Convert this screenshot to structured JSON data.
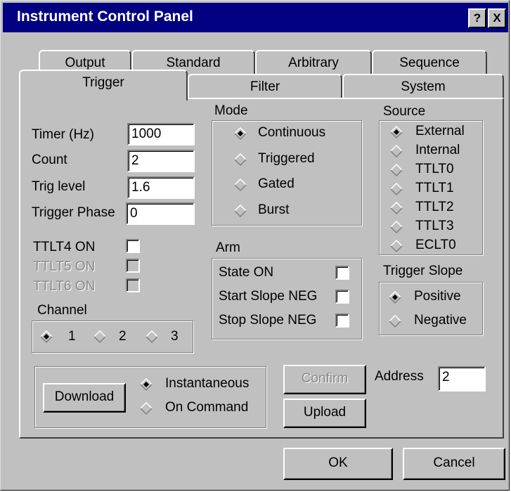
{
  "window": {
    "title": "Instrument Control Panel",
    "help_label": "?",
    "close_label": "X"
  },
  "tabs": {
    "row1": [
      "Output",
      "Standard",
      "Arbitrary",
      "Sequence"
    ],
    "row2": [
      "Trigger",
      "Filter",
      "System"
    ],
    "active": "Trigger"
  },
  "trigger": {
    "timer_label": "Timer (Hz)",
    "timer_value": "1000",
    "count_label": "Count",
    "count_value": "2",
    "level_label": "Trig level",
    "level_value": "1.6",
    "phase_label": "Trigger Phase",
    "phase_value": "0",
    "ttlt4_label": "TTLT4 ON",
    "ttlt4_checked": false,
    "ttlt5_label": "TTLT5 ON",
    "ttlt5_enabled": false,
    "ttlt6_label": "TTLT6 ON",
    "ttlt6_enabled": false
  },
  "channel": {
    "label": "Channel",
    "options": [
      "1",
      "2",
      "3"
    ],
    "selected": "1"
  },
  "mode": {
    "label": "Mode",
    "options": [
      "Continuous",
      "Triggered",
      "Gated",
      "Burst"
    ],
    "selected": "Continuous"
  },
  "arm": {
    "label": "Arm",
    "state_label": "State ON",
    "start_label": "Start Slope NEG",
    "stop_label": "Stop Slope NEG"
  },
  "source": {
    "label": "Source",
    "options": [
      "External",
      "Internal",
      "TTLT0",
      "TTLT1",
      "TTLT2",
      "TTLT3",
      "ECLT0"
    ],
    "selected": "External"
  },
  "slope": {
    "label": "Trigger Slope",
    "options": [
      "Positive",
      "Negative"
    ],
    "selected": "Positive"
  },
  "download": {
    "button_label": "Download",
    "options": [
      "Instantaneous",
      "On Command"
    ],
    "selected": "Instantaneous"
  },
  "actions": {
    "confirm_label": "Confirm",
    "upload_label": "Upload",
    "address_label": "Address",
    "address_value": "2",
    "ok_label": "OK",
    "cancel_label": "Cancel"
  }
}
